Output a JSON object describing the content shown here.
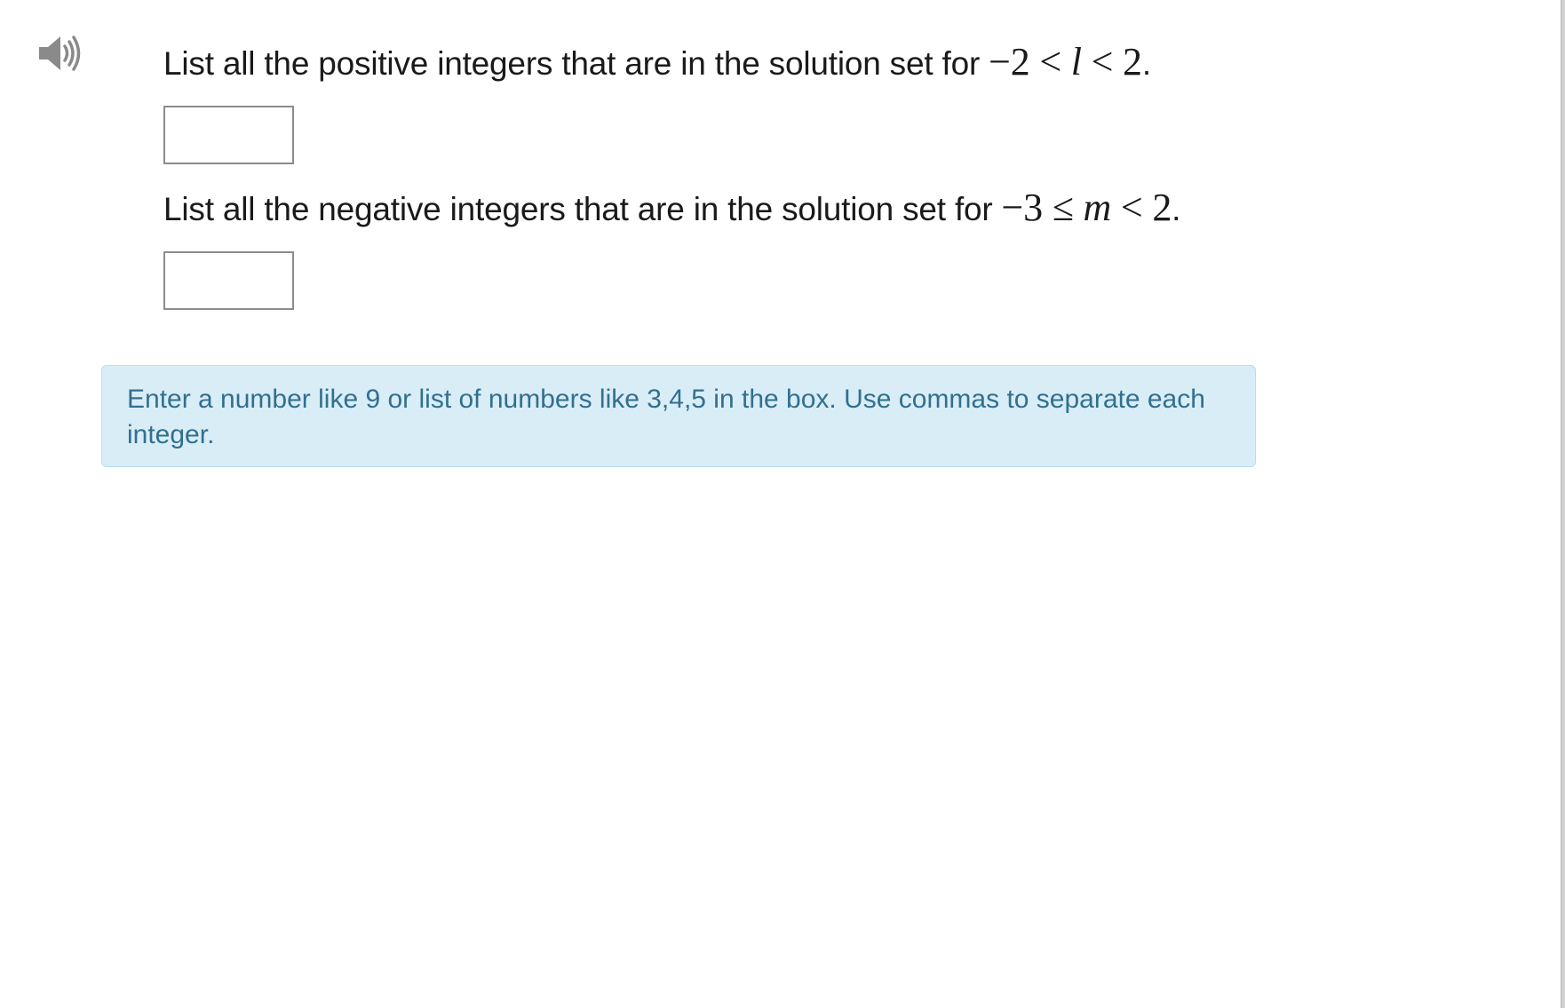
{
  "audio": {
    "icon": "speaker-volume-icon",
    "color": "#7a7a7a"
  },
  "questions": [
    {
      "prompt": "List all the positive integers that are in the solution set for",
      "math": {
        "lhs": "−2",
        "op1": "<",
        "var": "l",
        "op2": "<",
        "rhs": "2"
      },
      "period": ".",
      "answer_value": "",
      "answer_placeholder": ""
    },
    {
      "prompt": "List all the negative integers that are in the solution set for",
      "math": {
        "lhs": "−3",
        "op1": "≤",
        "var": "m",
        "op2": "<",
        "rhs": "2"
      },
      "period": ".",
      "answer_value": "",
      "answer_placeholder": ""
    }
  ],
  "info": {
    "text": "Enter a number like 9 or list of numbers like 3,4,5 in the box. Use commas to separate each integer.",
    "background": "#d9edf7",
    "text_color": "#31708f"
  }
}
